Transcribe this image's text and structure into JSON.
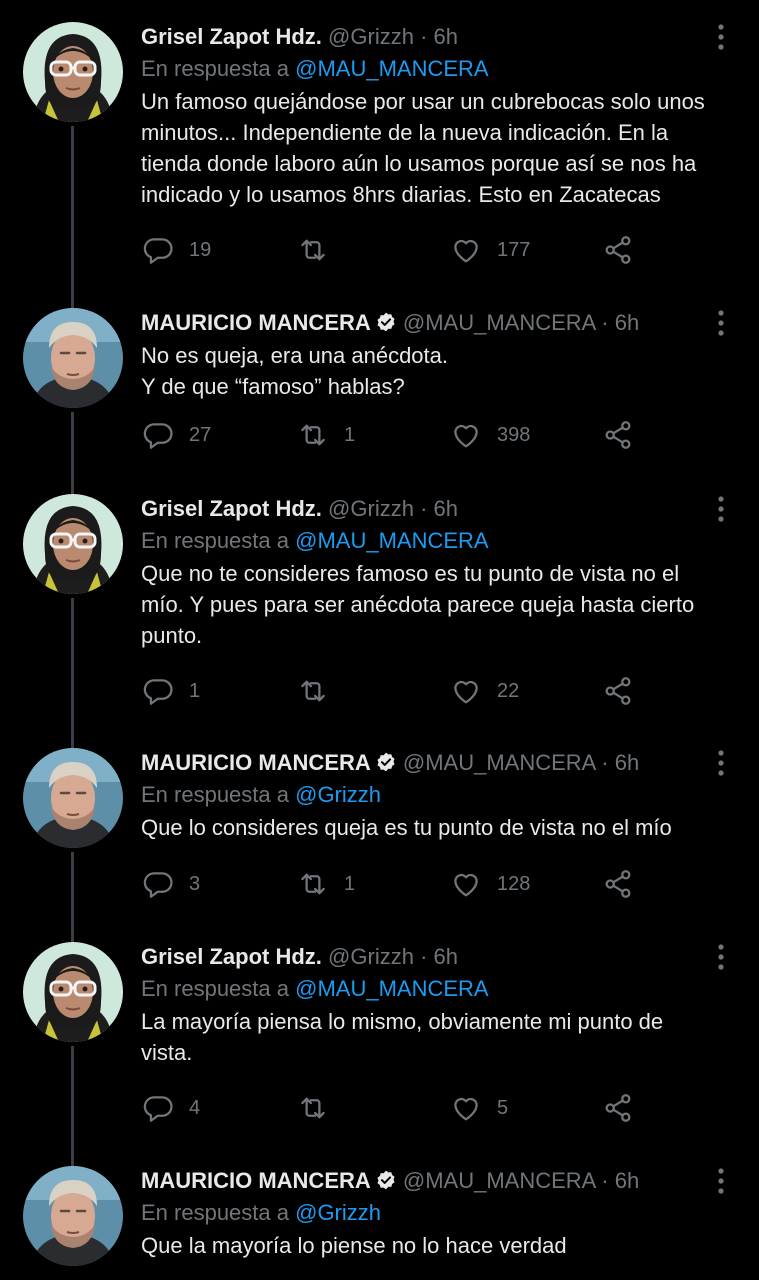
{
  "colors": {
    "background": "#000000",
    "text_primary": "#e7e9ea",
    "text_secondary": "#71767b",
    "link": "#1d9bf0",
    "thread_line": "#3a3f45",
    "verified": "#e7e9ea"
  },
  "labels": {
    "reply_prefix": "En respuesta a",
    "separator": "·",
    "more_icon": "more-vertical-icon"
  },
  "tweets": [
    {
      "author": "Grisel Zapot Hdz.",
      "handle": "@Grizzh",
      "time": "6h",
      "verified": false,
      "reply_to": "@MAU_MANCERA",
      "text_lines": [
        "Un famoso quejándose por usar un cubrebocas solo unos",
        "minutos... Independiente de la nueva indicación. En la",
        "tienda donde laboro aún lo usamos porque así se nos ha",
        "indicado y lo usamos 8hrs diarias. Esto en Zacatecas"
      ],
      "replies": "19",
      "retweets": "",
      "likes": "177"
    },
    {
      "author": "MAURICIO MANCERA",
      "handle": "@MAU_MANCERA",
      "time": "6h",
      "verified": true,
      "reply_to": "",
      "text_lines": [
        "No es queja, era una anécdota.",
        "Y de que “famoso” hablas?"
      ],
      "replies": "27",
      "retweets": "1",
      "likes": "398"
    },
    {
      "author": "Grisel Zapot Hdz.",
      "handle": "@Grizzh",
      "time": "6h",
      "verified": false,
      "reply_to": "@MAU_MANCERA",
      "text_lines": [
        "Que no te consideres famoso es tu punto de vista no el",
        "mío. Y pues para ser anécdota parece queja hasta cierto",
        "punto."
      ],
      "replies": "1",
      "retweets": "",
      "likes": "22"
    },
    {
      "author": "MAURICIO MANCERA",
      "handle": "@MAU_MANCERA",
      "time": "6h",
      "verified": true,
      "reply_to": "@Grizzh",
      "text_lines": [
        "Que lo consideres queja es tu punto de vista no el mío"
      ],
      "replies": "3",
      "retweets": "1",
      "likes": "128"
    },
    {
      "author": "Grisel Zapot Hdz.",
      "handle": "@Grizzh",
      "time": "6h",
      "verified": false,
      "reply_to": "@MAU_MANCERA",
      "text_lines": [
        "La mayoría piensa lo mismo, obviamente mi punto de",
        "vista."
      ],
      "replies": "4",
      "retweets": "",
      "likes": "5"
    },
    {
      "author": "MAURICIO MANCERA",
      "handle": "@MAU_MANCERA",
      "time": "6h",
      "verified": true,
      "reply_to": "@Grizzh",
      "text_lines": [
        "Que la mayoría lo piense no lo hace verdad"
      ],
      "replies": "",
      "retweets": "",
      "likes": ""
    }
  ]
}
